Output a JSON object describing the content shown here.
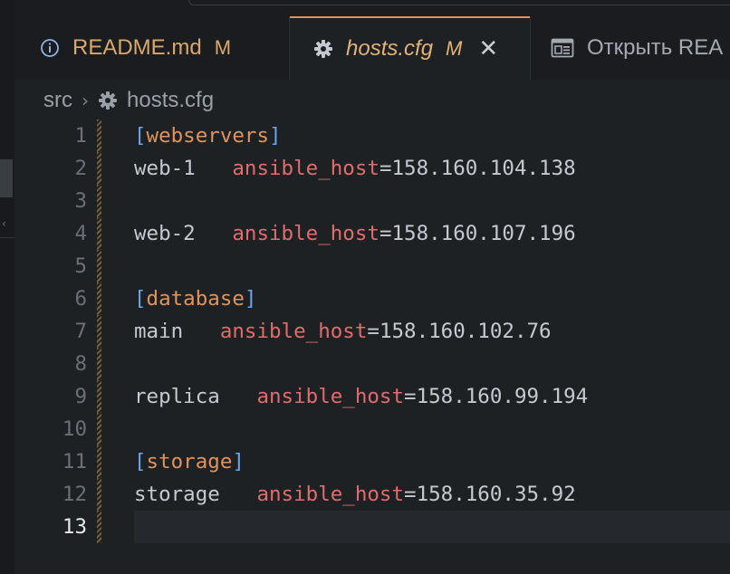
{
  "tabs": [
    {
      "label": "README.md",
      "badge": "M",
      "icon": "info-icon"
    },
    {
      "label": "hosts.cfg",
      "badge": "M",
      "icon": "gear-icon",
      "active": true,
      "close": "✕"
    },
    {
      "label": "Открыть REA",
      "icon": "preview-icon"
    }
  ],
  "breadcrumb": {
    "folder": "src",
    "separator": "›",
    "file": "hosts.cfg"
  },
  "editor": {
    "current_line": 13,
    "lines": [
      {
        "n": "1",
        "section": "webservers"
      },
      {
        "n": "2",
        "host": "web-1",
        "gap": "   ",
        "key": "ansible_host",
        "value": "158.160.104.138"
      },
      {
        "n": "3"
      },
      {
        "n": "4",
        "host": "web-2",
        "gap": "   ",
        "key": "ansible_host",
        "value": "158.160.107.196"
      },
      {
        "n": "5"
      },
      {
        "n": "6",
        "section": "database"
      },
      {
        "n": "7",
        "host": "main",
        "gap": "   ",
        "key": "ansible_host",
        "value": "158.160.102.76"
      },
      {
        "n": "8"
      },
      {
        "n": "9",
        "host": "replica",
        "gap": "   ",
        "key": "ansible_host",
        "value": "158.160.99.194"
      },
      {
        "n": "10"
      },
      {
        "n": "11",
        "section": "storage"
      },
      {
        "n": "12",
        "host": "storage",
        "gap": "   ",
        "key": "ansible_host",
        "value": "158.160.35.92"
      },
      {
        "n": "13"
      }
    ]
  },
  "colors": {
    "accent": "#e0935c",
    "section": "#e0935c",
    "bracket": "#6aa5e8",
    "key": "#e06c6c",
    "text": "#c5c9d0"
  }
}
